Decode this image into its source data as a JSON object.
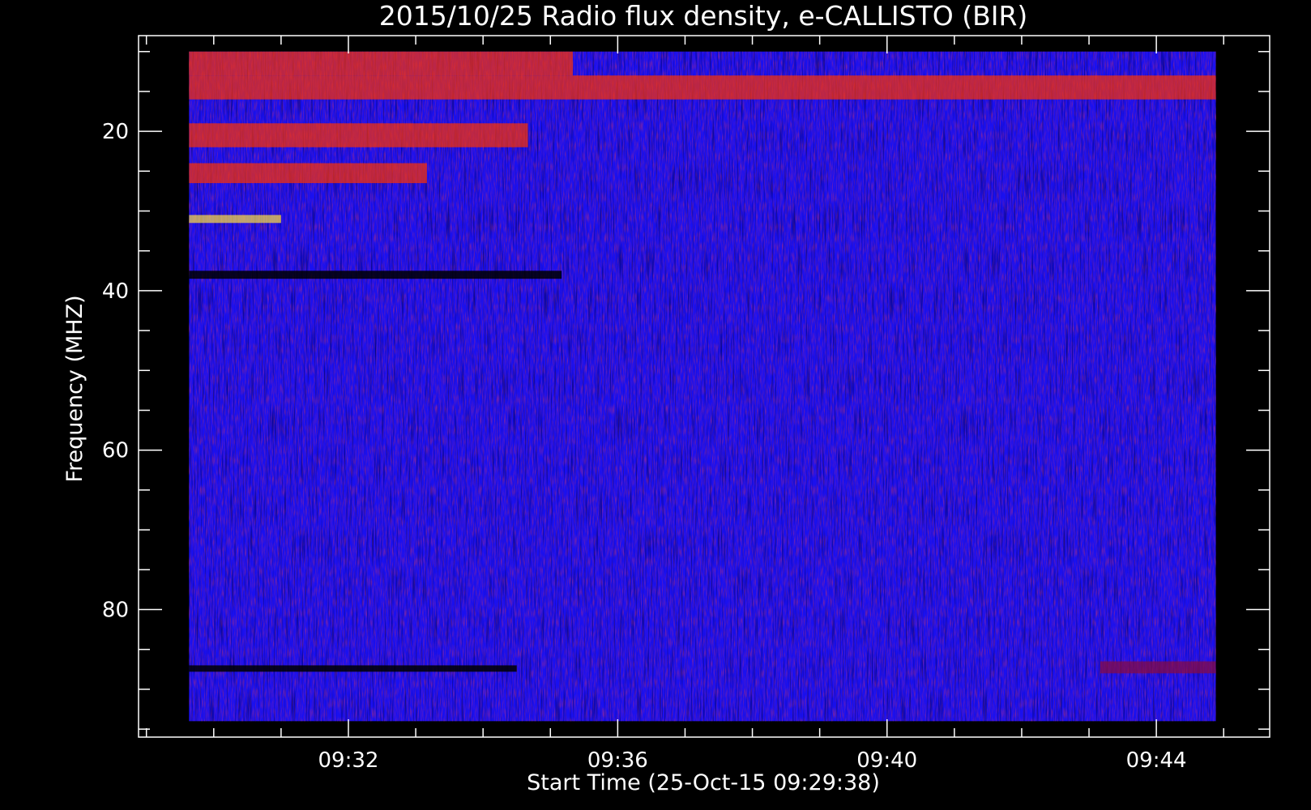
{
  "chart_data": {
    "type": "heatmap",
    "title": "2015/10/25  Radio flux density, e-CALLISTO (BIR)",
    "xlabel": "Start Time (25-Oct-15 09:29:38)",
    "ylabel": "Frequency (MHZ)",
    "x_range": [
      "09:29:38",
      "09:44:53"
    ],
    "x_axis_range": [
      "09:28:53",
      "09:45:41"
    ],
    "x_major_ticks": [
      "09:32",
      "09:36",
      "09:40",
      "09:44"
    ],
    "x_minor_tick_step_minutes": 1,
    "y_range": [
      10,
      94
    ],
    "y_axis_range": [
      8,
      96
    ],
    "y_reversed": true,
    "y_major_ticks": [
      20,
      40,
      60,
      80
    ],
    "y_minor_tick_step": 5,
    "colormap": [
      "#000000",
      "#0000ff",
      "#8b0a3c",
      "#ff3000",
      "#ffe040"
    ],
    "background_color": "#1a10f0",
    "bands": [
      {
        "t0": "09:29:38",
        "t1": "09:35:20",
        "f0": 10,
        "f1": 13,
        "level": 0.75
      },
      {
        "t0": "09:29:38",
        "t1": "09:44:53",
        "f0": 13,
        "f1": 16,
        "level": 0.55
      },
      {
        "t0": "09:29:38",
        "t1": "09:34:40",
        "f0": 19,
        "f1": 22,
        "level": 0.7
      },
      {
        "t0": "09:29:38",
        "t1": "09:33:10",
        "f0": 24,
        "f1": 26.5,
        "level": 0.65
      },
      {
        "t0": "09:29:38",
        "t1": "09:31:00",
        "f0": 30.5,
        "f1": 31.5,
        "level": 0.9
      },
      {
        "t0": "09:29:38",
        "t1": "09:35:10",
        "f0": 37.5,
        "f1": 38.5,
        "level": 0.0
      },
      {
        "t0": "09:29:38",
        "t1": "09:34:30",
        "f0": 87,
        "f1": 87.8,
        "level": 0.0
      },
      {
        "t0": "09:43:10",
        "t1": "09:44:53",
        "f0": 86.5,
        "f1": 88,
        "level": 0.45
      }
    ]
  }
}
